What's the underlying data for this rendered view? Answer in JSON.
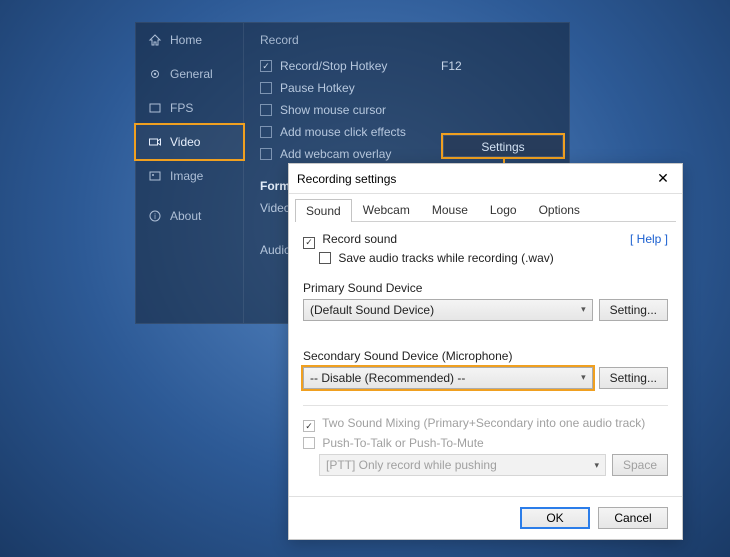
{
  "sidebar": {
    "items": [
      {
        "label": "Home",
        "icon": "home-icon"
      },
      {
        "label": "General",
        "icon": "gear-icon"
      },
      {
        "label": "FPS",
        "icon": "fps-icon"
      },
      {
        "label": "Video",
        "icon": "video-icon"
      },
      {
        "label": "Image",
        "icon": "image-icon"
      },
      {
        "label": "About",
        "icon": "info-icon"
      }
    ]
  },
  "record": {
    "section_title": "Record",
    "items": [
      {
        "label": "Record/Stop Hotkey",
        "checked": true,
        "value": "F12"
      },
      {
        "label": "Pause Hotkey",
        "checked": false,
        "value": ""
      },
      {
        "label": "Show mouse cursor",
        "checked": false,
        "value": ""
      },
      {
        "label": "Add mouse click effects",
        "checked": false,
        "value": ""
      },
      {
        "label": "Add webcam overlay",
        "checked": false,
        "value": ""
      }
    ],
    "settings_button": "Settings"
  },
  "format_section": {
    "title": "Format",
    "video_label": "Video",
    "audio_label": "Audio"
  },
  "modal": {
    "title": "Recording settings",
    "tabs": [
      "Sound",
      "Webcam",
      "Mouse",
      "Logo",
      "Options"
    ],
    "active_tab": "Sound",
    "help_label": "[ Help ]",
    "record_sound_label": "Record sound",
    "save_tracks_label": "Save audio tracks while recording (.wav)",
    "primary_label": "Primary Sound Device",
    "primary_value": "(Default Sound Device)",
    "secondary_label": "Secondary Sound Device (Microphone)",
    "secondary_value": "-- Disable (Recommended) --",
    "setting_button": "Setting...",
    "mixing_label": "Two Sound Mixing (Primary+Secondary into one audio track)",
    "ptt_label": "Push-To-Talk or Push-To-Mute",
    "ptt_mode_value": "[PTT] Only record while pushing",
    "ptt_key": "Space",
    "ok": "OK",
    "cancel": "Cancel"
  },
  "colors": {
    "highlight": "#f0a020"
  }
}
